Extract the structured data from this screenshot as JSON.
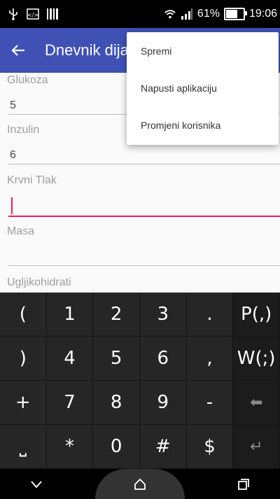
{
  "status_bar": {
    "battery": "61%",
    "time": "19:06",
    "battery_level": 0.61
  },
  "app_bar": {
    "title": "Dnevnik dija"
  },
  "form": {
    "fields": [
      {
        "label": "Glukoza",
        "value": "5"
      },
      {
        "label": "Inzulin",
        "value": "6"
      },
      {
        "label": "Krvni Tlak",
        "value": ""
      },
      {
        "label": "Masa",
        "value": ""
      },
      {
        "label": "Ugljikohidrati",
        "value": ""
      }
    ]
  },
  "menu": {
    "items": [
      "Spremi",
      "Napusti aplikaciju",
      "Promjeni korisnika"
    ]
  },
  "keyboard": {
    "rows": [
      [
        "(",
        "1",
        "2",
        "3",
        ".",
        "P(,)"
      ],
      [
        ")",
        "4",
        "5",
        "6",
        ",",
        "W(;)"
      ],
      [
        "+",
        "7",
        "8",
        "9",
        "-",
        "⬅"
      ],
      [
        "⎵",
        "*",
        "0",
        "#",
        "$",
        "↵"
      ]
    ]
  },
  "colors": {
    "app_bar": "#3f51b5",
    "accent": "#e91e63"
  }
}
